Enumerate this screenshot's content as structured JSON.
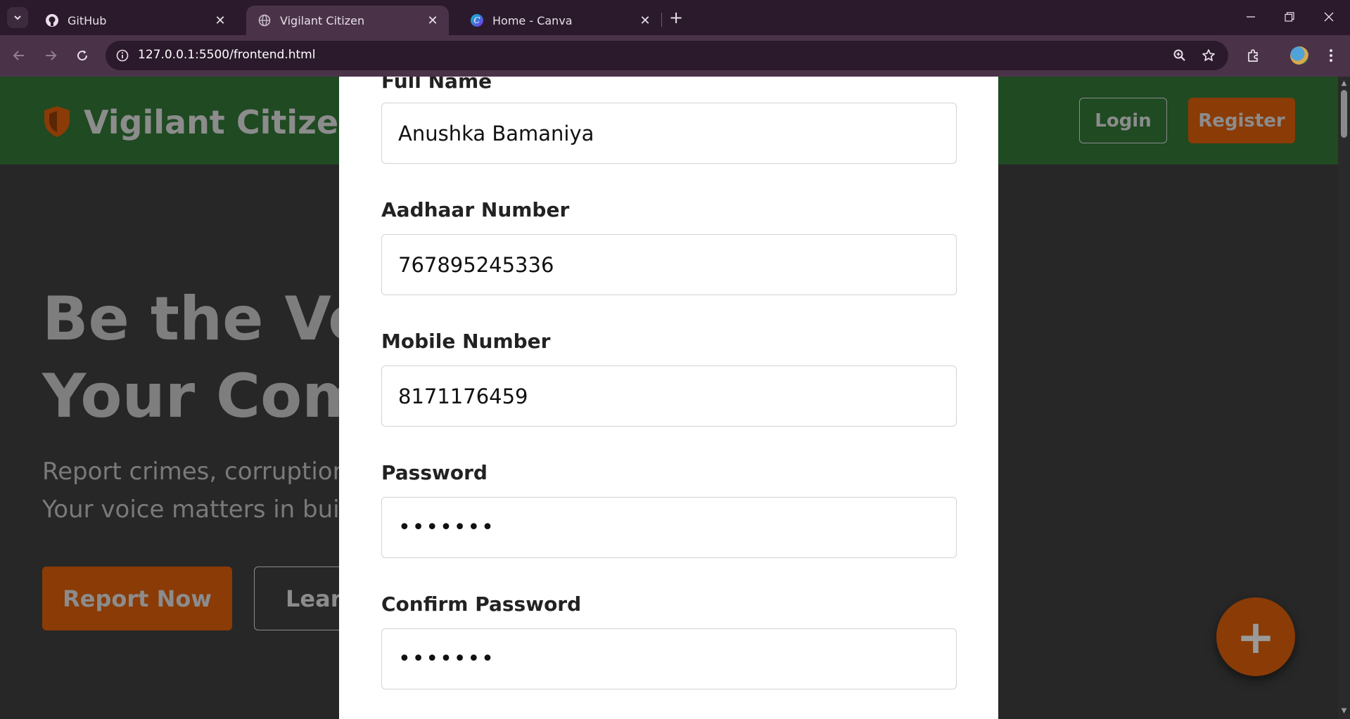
{
  "browser": {
    "tabs": [
      {
        "title": "GitHub",
        "icon": "github-icon"
      },
      {
        "title": "Vigilant Citizen",
        "icon": "globe-icon"
      },
      {
        "title": "Home - Canva",
        "icon": "canva-icon"
      }
    ],
    "url": "127.0.0.1:5500/frontend.html",
    "tab_close_glyph": "✕",
    "new_tab_glyph": "+"
  },
  "site": {
    "brand": "Vigilant Citizen",
    "login_label": "Login",
    "register_label": "Register",
    "hero_title_line1": "Be the Voi",
    "hero_title_line2": "Your Comm",
    "hero_sub_line1": "Report crimes, corruption,",
    "hero_sub_line2": "Your voice matters in build",
    "report_label": "Report Now",
    "learn_label": "Learn",
    "fab_glyph": "+",
    "colors": {
      "header_green": "#1f4a22",
      "accent_orange": "#8a3b06",
      "overlay_bg": "#272727"
    }
  },
  "modal": {
    "fields": [
      {
        "label": "Full Name",
        "value": "Anushka Bamaniya"
      },
      {
        "label": "Aadhaar Number",
        "value": "767895245336"
      },
      {
        "label": "Mobile Number",
        "value": "8171176459"
      },
      {
        "label": "Password",
        "value": "•••••••"
      },
      {
        "label": "Confirm Password",
        "value": "•••••••"
      }
    ]
  }
}
